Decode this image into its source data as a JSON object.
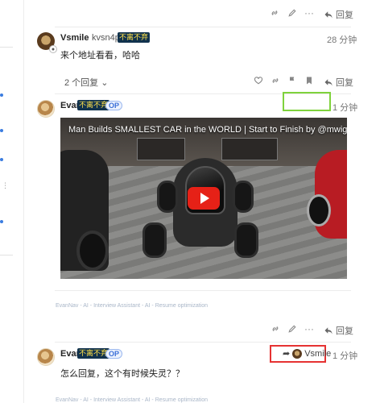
{
  "top_actions": {
    "reply_label": "回复"
  },
  "post1": {
    "username": "Vsmile",
    "handle": "kvsn4p9mtz",
    "flair": "不离不弃",
    "time": "28 分钟",
    "text": "来个地址看看，哈哈",
    "replies_label": "2 个回复",
    "reply_label": "回复"
  },
  "post2": {
    "username": "Evan",
    "flair": "不离不弃",
    "op_badge": "OP",
    "time": "1 分钟",
    "video_title": "Man Builds SMALLEST CAR in the WORLD | Start to Finish by @mwigmedia",
    "footer": "EvanNav - AI - Interview Assistant - AI - Resume optimization",
    "reply_label": "回复"
  },
  "post3": {
    "username": "Evan",
    "flair": "不离不弃",
    "op_badge": "OP",
    "reply_to_user": "Vsmile",
    "time": "1 分钟",
    "text": "怎么回复，这个有时候失灵？？",
    "footer": "EvanNav - AI - Interview Assistant - AI - Resume optimization"
  },
  "colors": {
    "accent": "#3b7de0",
    "highlight_green": "#7fd23c",
    "highlight_red": "#e63232",
    "flair_bg": "#11324d",
    "flair_fg": "#ffe14a"
  }
}
